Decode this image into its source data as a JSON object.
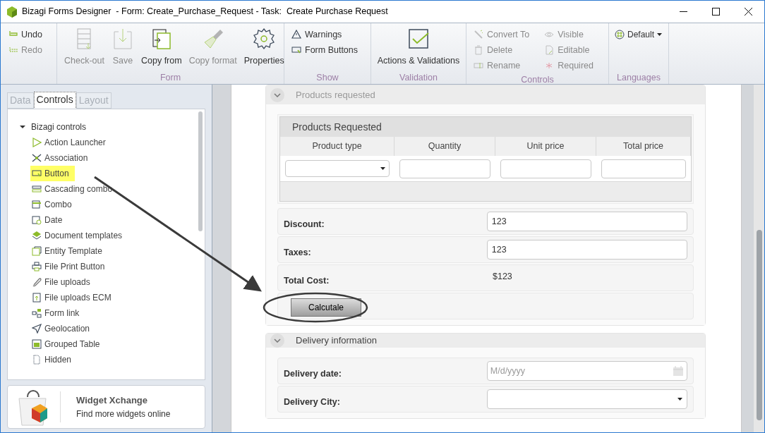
{
  "window": {
    "title": "Bizagi Forms Designer  - Form: Create_Purchase_Request - Task:  Create Purchase Request"
  },
  "ribbon": {
    "groups": [
      {
        "items": [
          {
            "label": "Undo",
            "kind": "small",
            "disabled": false
          },
          {
            "label": "Redo",
            "kind": "small",
            "disabled": true
          }
        ]
      },
      {
        "label": "Form",
        "items": [
          {
            "label": "Check-out",
            "kind": "big",
            "disabled": true
          },
          {
            "label": "Save",
            "kind": "big",
            "disabled": true
          },
          {
            "label": "Copy from",
            "kind": "big",
            "disabled": false
          },
          {
            "label": "Copy format",
            "kind": "big",
            "disabled": true
          },
          {
            "label": "Properties",
            "kind": "big",
            "disabled": false
          }
        ]
      },
      {
        "label": "Show",
        "items": [
          {
            "label": "Warnings",
            "kind": "small",
            "disabled": false
          },
          {
            "label": "Form Buttons",
            "kind": "small",
            "disabled": false
          }
        ]
      },
      {
        "label": "Validation",
        "items": [
          {
            "label": "Actions & Validations",
            "kind": "big",
            "disabled": false
          }
        ]
      },
      {
        "label": "Controls",
        "items": [
          {
            "label": "Convert To",
            "kind": "small",
            "disabled": true
          },
          {
            "label": "Delete",
            "kind": "small",
            "disabled": true
          },
          {
            "label": "Rename",
            "kind": "small",
            "disabled": true
          },
          {
            "label": "Visible",
            "kind": "small",
            "disabled": true
          },
          {
            "label": "Editable",
            "kind": "small",
            "disabled": true
          },
          {
            "label": "Required",
            "kind": "small",
            "disabled": true
          }
        ]
      },
      {
        "label": "Languages",
        "items": [
          {
            "label": "Default",
            "kind": "dropdown",
            "disabled": false
          }
        ]
      }
    ]
  },
  "left_panel": {
    "tabs": [
      {
        "label": "Data",
        "selected": false
      },
      {
        "label": "Controls",
        "selected": true
      },
      {
        "label": "Layout",
        "selected": false
      }
    ],
    "tree": {
      "label": "Bizagi controls",
      "expanded": true,
      "children": [
        {
          "label": "Action Launcher",
          "selected": false
        },
        {
          "label": "Association",
          "selected": false
        },
        {
          "label": "Button",
          "selected": true
        },
        {
          "label": "Cascading combo",
          "selected": false
        },
        {
          "label": "Combo",
          "selected": false
        },
        {
          "label": "Date",
          "selected": false
        },
        {
          "label": "Document templates",
          "selected": false
        },
        {
          "label": "Entity Template",
          "selected": false
        },
        {
          "label": "File Print Button",
          "selected": false
        },
        {
          "label": "File uploads",
          "selected": false
        },
        {
          "label": "File uploads ECM",
          "selected": false
        },
        {
          "label": "Form link",
          "selected": false
        },
        {
          "label": "Geolocation",
          "selected": false
        },
        {
          "label": "Grouped Table",
          "selected": false
        },
        {
          "label": "Hidden",
          "selected": false
        }
      ]
    },
    "widget_xchange": {
      "title": "Widget Xchange",
      "subtitle": "Find more widgets online"
    }
  },
  "form": {
    "sections": [
      {
        "title": "Products requested",
        "expanded": true,
        "table": {
          "title": "Products Requested",
          "columns": [
            "Product type",
            "Quantity",
            "Unit price",
            "Total price"
          ],
          "cells": [
            {
              "kind": "dropdown"
            },
            {
              "kind": "text"
            },
            {
              "kind": "text"
            },
            {
              "kind": "text"
            }
          ]
        },
        "fields": [
          {
            "label": "Discount:",
            "kind": "text",
            "value": "123"
          },
          {
            "label": "Taxes:",
            "kind": "text",
            "value": "123"
          },
          {
            "label": "Total Cost:",
            "kind": "readonly",
            "value": "$123"
          },
          {
            "label": "Calcutale",
            "kind": "button"
          }
        ]
      },
      {
        "title": "Delivery information",
        "expanded": true,
        "fields": [
          {
            "label": "Delivery date:",
            "kind": "date",
            "placeholder": "M/d/yyyy"
          },
          {
            "label": "Delivery City:",
            "kind": "dropdown"
          }
        ]
      }
    ]
  }
}
